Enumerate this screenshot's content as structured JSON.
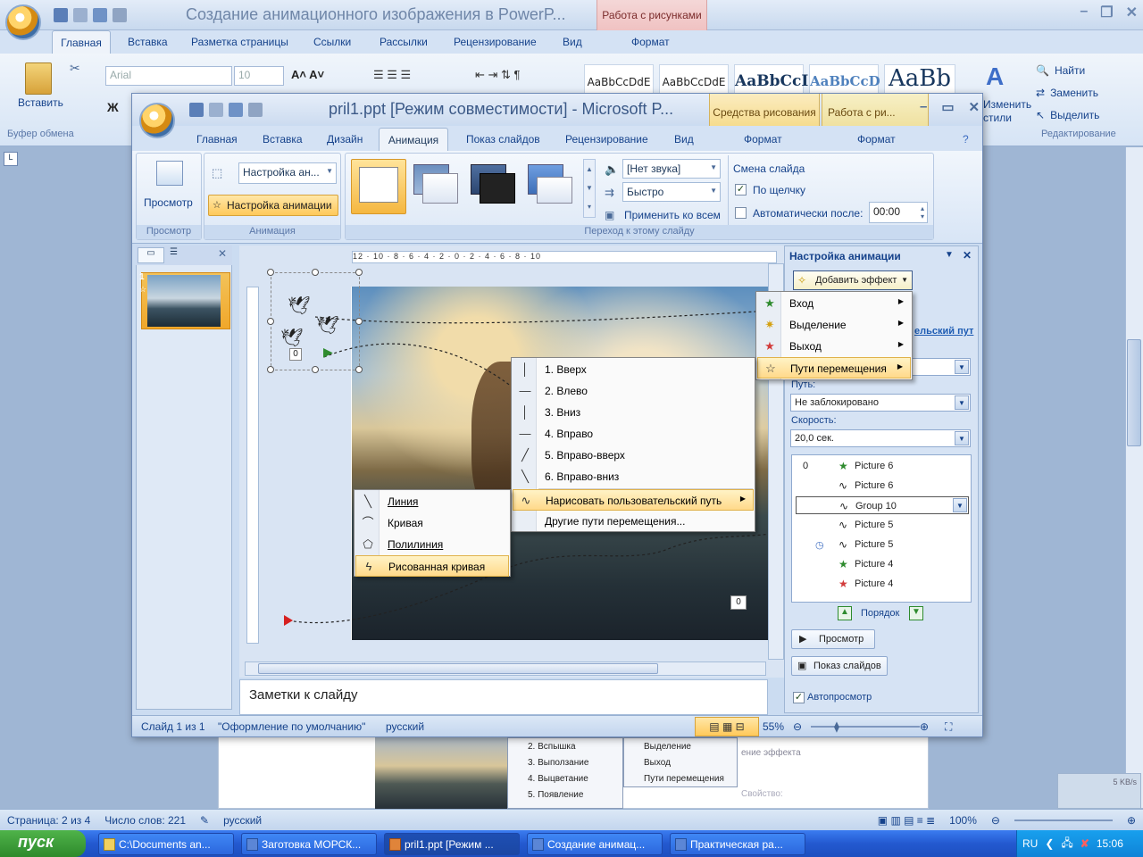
{
  "word": {
    "title": "Создание анимационного изображения в PowerP...",
    "context_tab": "Работа с рисунками",
    "tabs": [
      "Главная",
      "Вставка",
      "Разметка страницы",
      "Ссылки",
      "Рассылки",
      "Рецензирование",
      "Вид",
      "Формат"
    ],
    "font_name": "Arial",
    "font_size": "10",
    "paste_label": "Вставить",
    "clipboard_label": "Буфер обмена",
    "styles": [
      "AaBbCcDdE",
      "AaBbCcDdE",
      "AaBbCcI",
      "AaBbCcD",
      "AaBb"
    ],
    "change_styles_1": "Изменить",
    "change_styles_2": "стили",
    "find": "Найти",
    "replace": "Заменить",
    "select": "Выделить",
    "editing_label": "Редактирование",
    "status_page": "Страница: 2 из 4",
    "status_words": "Число слов: 221",
    "status_lang": "русский",
    "status_zoom": "100%",
    "net_speed": "5 KB/s",
    "mini_menu1": [
      "2. Вспышка",
      "3. Выползание",
      "4. Выцветание",
      "5. Появление"
    ],
    "mini_menu2": [
      "Выделение",
      "Выход",
      "Пути перемещения"
    ],
    "mini_text": [
      "ение эффекта",
      "Свойство:"
    ]
  },
  "pp": {
    "title": "pril1.ppt [Режим совместимости] - Microsoft P...",
    "context_tab1": "Средства рисования",
    "context_tab2": "Работа с ри...",
    "tabs": [
      "Главная",
      "Вставка",
      "Дизайн",
      "Анимация",
      "Показ слайдов",
      "Рецензирование",
      "Вид",
      "Формат",
      "Формат"
    ],
    "preview_btn": "Просмотр",
    "preview_group": "Просмотр",
    "anim_dropdown": "Настройка ан...",
    "anim_btn": "Настройка анимации",
    "anim_group": "Анимация",
    "sound_dd": "[Нет звука]",
    "speed_dd": "Быстро",
    "apply_all": "Применить ко всем",
    "transition_group": "Переход к этому слайду",
    "advance_label": "Смена слайда",
    "on_click": "По щелчку",
    "auto_after": "Автоматически после:",
    "auto_time": "00:00",
    "ruler": "12 · 10 · 8 · 6 · 4 · 2 · 0 · 2 · 4 · 6 · 8 · 10",
    "notes": "Заметки к слайду",
    "slide_number": "1",
    "badge_zero_1": "0",
    "badge_zero_2": "0",
    "status_slide": "Слайд 1 из 1",
    "status_theme": "\"Оформление по умолчанию\"",
    "status_lang": "русский",
    "zoom": "55%"
  },
  "taskpane": {
    "title": "Настройка анимации",
    "add_effect": "Добавить эффект",
    "partial_link": "ельский пут",
    "path_label": "Путь:",
    "path_value": "Не заблокировано",
    "speed_label": "Скорость:",
    "speed_value": "20,0 сек.",
    "rows": [
      {
        "num": "0",
        "icon": "★",
        "color": "#2e8b2e",
        "name": "Picture 6"
      },
      {
        "num": "",
        "icon": "∿",
        "color": "#333",
        "name": "Picture 6"
      },
      {
        "num": "",
        "icon": "∿",
        "color": "#333",
        "name": "Group 10"
      },
      {
        "num": "",
        "icon": "∿",
        "color": "#333",
        "name": "Picture 5"
      },
      {
        "num": "◷",
        "icon": "∿",
        "color": "#333",
        "name": "Picture 5"
      },
      {
        "num": "",
        "icon": "★",
        "color": "#2e8b2e",
        "name": "Picture 4"
      },
      {
        "num": "",
        "icon": "★",
        "color": "#d23b3b",
        "name": "Picture 4"
      }
    ],
    "order": "Порядок",
    "preview": "Просмотр",
    "slideshow": "Показ слайдов",
    "autopreview": "Автопросмотр"
  },
  "menu_effect": {
    "items": [
      "Вход",
      "Выделение",
      "Выход",
      "Пути перемещения"
    ]
  },
  "menu_paths": {
    "items": [
      "1. Вверх",
      "2. Влево",
      "3. Вниз",
      "4. Вправо",
      "5. Вправо-вверх",
      "6. Вправо-вниз",
      "Нарисовать пользовательский путь",
      "Другие пути перемещения..."
    ]
  },
  "menu_draw": {
    "items": [
      "Линия",
      "Кривая",
      "Полилиния",
      "Рисованная кривая"
    ]
  },
  "taskbar": {
    "start": "пуск",
    "tasks": [
      "C:\\Documents an...",
      "Заготовка МОРСК...",
      "pril1.ppt [Режим ...",
      "Создание анимац...",
      "Практическая ра..."
    ],
    "lang": "RU",
    "clock": "15:06"
  },
  "colors": {
    "ribbon_blue": "#d4e2f4",
    "highlight": "#ffd98a",
    "taskbar": "#2359d0"
  }
}
